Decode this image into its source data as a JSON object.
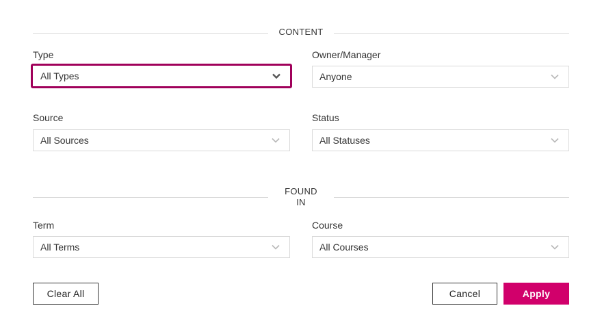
{
  "sections": {
    "content": "CONTENT",
    "found_in": "FOUND IN"
  },
  "fields": {
    "type": {
      "label": "Type",
      "value": "All Types"
    },
    "owner": {
      "label": "Owner/Manager",
      "value": "Anyone"
    },
    "source": {
      "label": "Source",
      "value": "All Sources"
    },
    "status": {
      "label": "Status",
      "value": "All Statuses"
    },
    "term": {
      "label": "Term",
      "value": "All Terms"
    },
    "course": {
      "label": "Course",
      "value": "All Courses"
    }
  },
  "buttons": {
    "clear_all": "Clear All",
    "cancel": "Cancel",
    "apply": "Apply"
  },
  "colors": {
    "focus_border": "#a0005a",
    "primary_button": "#d1006b",
    "divider": "#d9d9d9"
  },
  "icons": {
    "dropdown": "chevron-down-icon"
  }
}
